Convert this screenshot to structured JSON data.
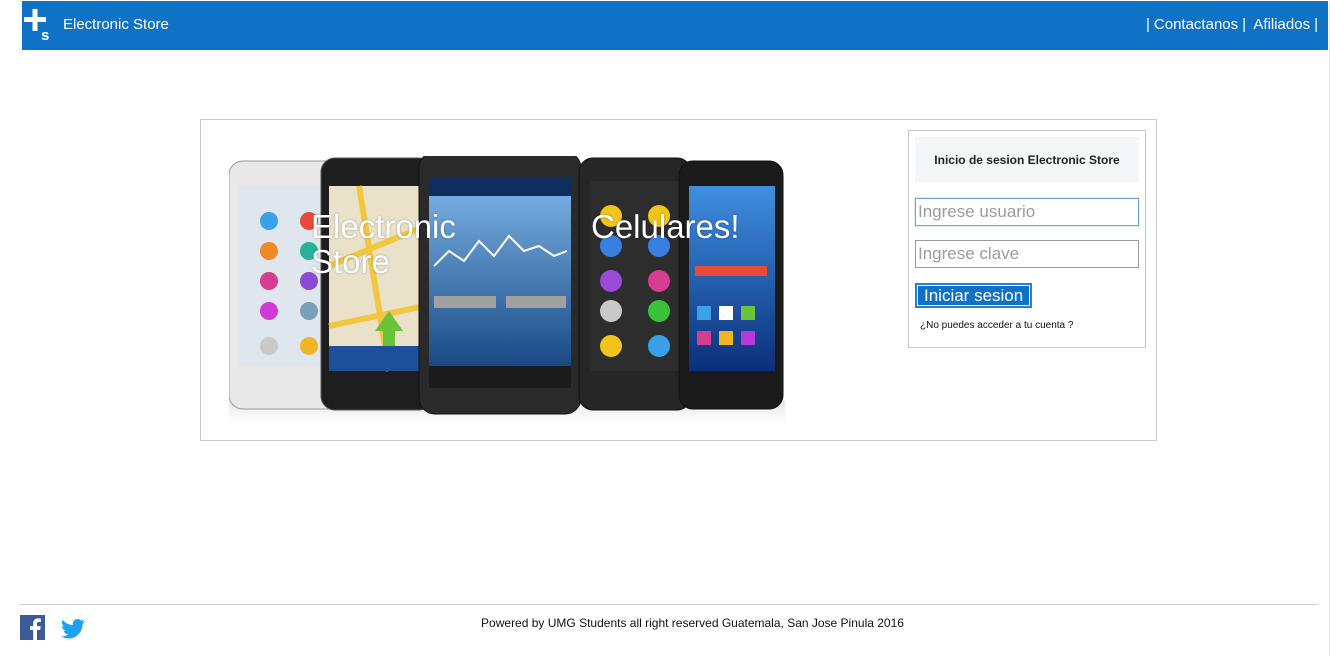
{
  "header": {
    "brand": "Electronic Store",
    "nav": [
      {
        "label": "Contactanos"
      },
      {
        "label": "Afiliados"
      }
    ],
    "separator": "|",
    "accent_color": "#0f72c5"
  },
  "hero": {
    "text_left": "Electronic Store",
    "text_right": "Celulares!"
  },
  "login": {
    "title": "Inicio de sesion Electronic Store",
    "username_placeholder": "Ingrese usuario",
    "username_value": "",
    "password_placeholder": "Ingrese clave",
    "password_value": "",
    "submit_label": "Iniciar sesion",
    "forgot_label": "¿No puedes acceder a tu cuenta ?"
  },
  "footer": {
    "copyright": "Powered by UMG Students all right reserved Guatemala, San Jose Pinula 2016",
    "social": [
      {
        "icon": "facebook-icon"
      },
      {
        "icon": "twitter-icon"
      }
    ]
  }
}
